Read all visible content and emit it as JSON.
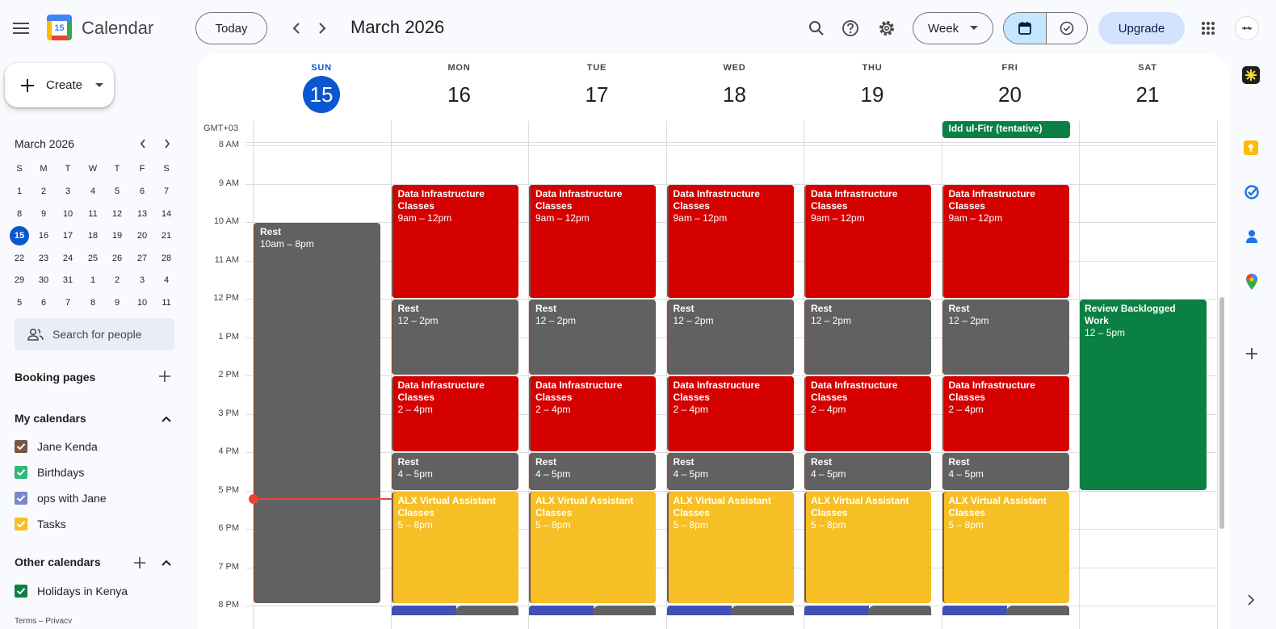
{
  "header": {
    "app_name": "Calendar",
    "logo_day": "15",
    "today_label": "Today",
    "month_title": "March 2026",
    "view_label": "Week",
    "upgrade_label": "Upgrade"
  },
  "sidebar": {
    "create_label": "Create",
    "mini_month": "March 2026",
    "dow": [
      "S",
      "M",
      "T",
      "W",
      "T",
      "F",
      "S"
    ],
    "weeks": [
      [
        "1",
        "2",
        "3",
        "4",
        "5",
        "6",
        "7"
      ],
      [
        "8",
        "9",
        "10",
        "11",
        "12",
        "13",
        "14"
      ],
      [
        "15",
        "16",
        "17",
        "18",
        "19",
        "20",
        "21"
      ],
      [
        "22",
        "23",
        "24",
        "25",
        "26",
        "27",
        "28"
      ],
      [
        "29",
        "30",
        "31",
        "1",
        "2",
        "3",
        "4"
      ],
      [
        "5",
        "6",
        "7",
        "8",
        "9",
        "10",
        "11"
      ]
    ],
    "search_people": "Search for people",
    "booking_pages": "Booking pages",
    "my_calendars_title": "My calendars",
    "my_calendars": [
      {
        "label": "Jane Kenda",
        "color": "#795548"
      },
      {
        "label": "Birthdays",
        "color": "#33b679"
      },
      {
        "label": "ops with Jane",
        "color": "#7986cb"
      },
      {
        "label": "Tasks",
        "color": "#f6bf26"
      }
    ],
    "other_calendars_title": "Other calendars",
    "other_calendars": [
      {
        "label": "Holidays in Kenya",
        "color": "#0b8043"
      }
    ],
    "footer": "Terms – Privacy"
  },
  "grid": {
    "timezone": "GMT+03",
    "days": [
      {
        "dow": "SUN",
        "num": "15",
        "today": true
      },
      {
        "dow": "MON",
        "num": "16"
      },
      {
        "dow": "TUE",
        "num": "17"
      },
      {
        "dow": "WED",
        "num": "18"
      },
      {
        "dow": "THU",
        "num": "19"
      },
      {
        "dow": "FRI",
        "num": "20"
      },
      {
        "dow": "SAT",
        "num": "21"
      }
    ],
    "hours": [
      "8 AM",
      "9 AM",
      "10 AM",
      "11 AM",
      "12 PM",
      "1 PM",
      "2 PM",
      "3 PM",
      "4 PM",
      "5 PM",
      "6 PM",
      "7 PM",
      "8 PM"
    ],
    "all_day": [
      {
        "day": 5,
        "title": "Idd ul-Fitr (tentative)",
        "color": "#0b8043"
      }
    ],
    "events": [
      {
        "day": 0,
        "title": "Rest",
        "time": "10am – 8pm",
        "start": 10,
        "end": 20,
        "kind": "gray"
      },
      {
        "day": 1,
        "title": "Data Infrastructure Classes",
        "time": "9am – 12pm",
        "start": 9,
        "end": 12,
        "kind": "red"
      },
      {
        "day": 2,
        "title": "Data Infrastructure Classes",
        "time": "9am – 12pm",
        "start": 9,
        "end": 12,
        "kind": "red"
      },
      {
        "day": 3,
        "title": "Data Infrastructure Classes",
        "time": "9am – 12pm",
        "start": 9,
        "end": 12,
        "kind": "red"
      },
      {
        "day": 4,
        "title": "Data Infrastructure Classes",
        "time": "9am – 12pm",
        "start": 9,
        "end": 12,
        "kind": "red"
      },
      {
        "day": 5,
        "title": "Data Infrastructure Classes",
        "time": "9am – 12pm",
        "start": 9,
        "end": 12,
        "kind": "red"
      },
      {
        "day": 1,
        "title": "Rest",
        "time": "12 – 2pm",
        "start": 12,
        "end": 14,
        "kind": "gray"
      },
      {
        "day": 2,
        "title": "Rest",
        "time": "12 – 2pm",
        "start": 12,
        "end": 14,
        "kind": "gray"
      },
      {
        "day": 3,
        "title": "Rest",
        "time": "12 – 2pm",
        "start": 12,
        "end": 14,
        "kind": "gray"
      },
      {
        "day": 4,
        "title": "Rest",
        "time": "12 – 2pm",
        "start": 12,
        "end": 14,
        "kind": "gray"
      },
      {
        "day": 5,
        "title": "Rest",
        "time": "12 – 2pm",
        "start": 12,
        "end": 14,
        "kind": "gray"
      },
      {
        "day": 6,
        "title": "Review Backlogged Work",
        "time": "12 – 5pm",
        "start": 12,
        "end": 17,
        "kind": "green"
      },
      {
        "day": 1,
        "title": "Data Infrastructure Classes",
        "time": "2 – 4pm",
        "start": 14,
        "end": 16,
        "kind": "red"
      },
      {
        "day": 2,
        "title": "Data Infrastructure Classes",
        "time": "2 – 4pm",
        "start": 14,
        "end": 16,
        "kind": "red"
      },
      {
        "day": 3,
        "title": "Data Infrastructure Classes",
        "time": "2 – 4pm",
        "start": 14,
        "end": 16,
        "kind": "red"
      },
      {
        "day": 4,
        "title": "Data Infrastructure Classes",
        "time": "2 – 4pm",
        "start": 14,
        "end": 16,
        "kind": "red"
      },
      {
        "day": 5,
        "title": "Data Infrastructure Classes",
        "time": "2 – 4pm",
        "start": 14,
        "end": 16,
        "kind": "red"
      },
      {
        "day": 1,
        "title": "Rest",
        "time": "4 – 5pm",
        "start": 16,
        "end": 17,
        "kind": "gray"
      },
      {
        "day": 2,
        "title": "Rest",
        "time": "4 – 5pm",
        "start": 16,
        "end": 17,
        "kind": "gray"
      },
      {
        "day": 3,
        "title": "Rest",
        "time": "4 – 5pm",
        "start": 16,
        "end": 17,
        "kind": "gray"
      },
      {
        "day": 4,
        "title": "Rest",
        "time": "4 – 5pm",
        "start": 16,
        "end": 17,
        "kind": "gray"
      },
      {
        "day": 5,
        "title": "Rest",
        "time": "4 – 5pm",
        "start": 16,
        "end": 17,
        "kind": "gray"
      },
      {
        "day": 1,
        "title": "ALX Virtual Assistant Classes",
        "time": "5 – 8pm",
        "start": 17,
        "end": 20,
        "kind": "yellow"
      },
      {
        "day": 2,
        "title": "ALX Virtual Assistant Classes",
        "time": "5 – 8pm",
        "start": 17,
        "end": 20,
        "kind": "yellow"
      },
      {
        "day": 3,
        "title": "ALX Virtual Assistant Classes",
        "time": "5 – 8pm",
        "start": 17,
        "end": 20,
        "kind": "yellow"
      },
      {
        "day": 4,
        "title": "ALX Virtual Assistant Classes",
        "time": "5 – 8pm",
        "start": 17,
        "end": 20,
        "kind": "yellow"
      },
      {
        "day": 5,
        "title": "ALX Virtual Assistant Classes",
        "time": "5 – 8pm",
        "start": 17,
        "end": 20,
        "kind": "yellow"
      }
    ],
    "now_hour": 17.2
  },
  "colors": {
    "accent": "#0b57d0",
    "red": "#d50000",
    "gray": "#616161",
    "yellow": "#f6bf26",
    "green": "#0b8043",
    "now_line": "#ea4335"
  },
  "rail_icons": [
    "ai-assistant-icon",
    "keep-icon",
    "tasks-icon",
    "contacts-icon",
    "maps-icon",
    "add-icon"
  ]
}
